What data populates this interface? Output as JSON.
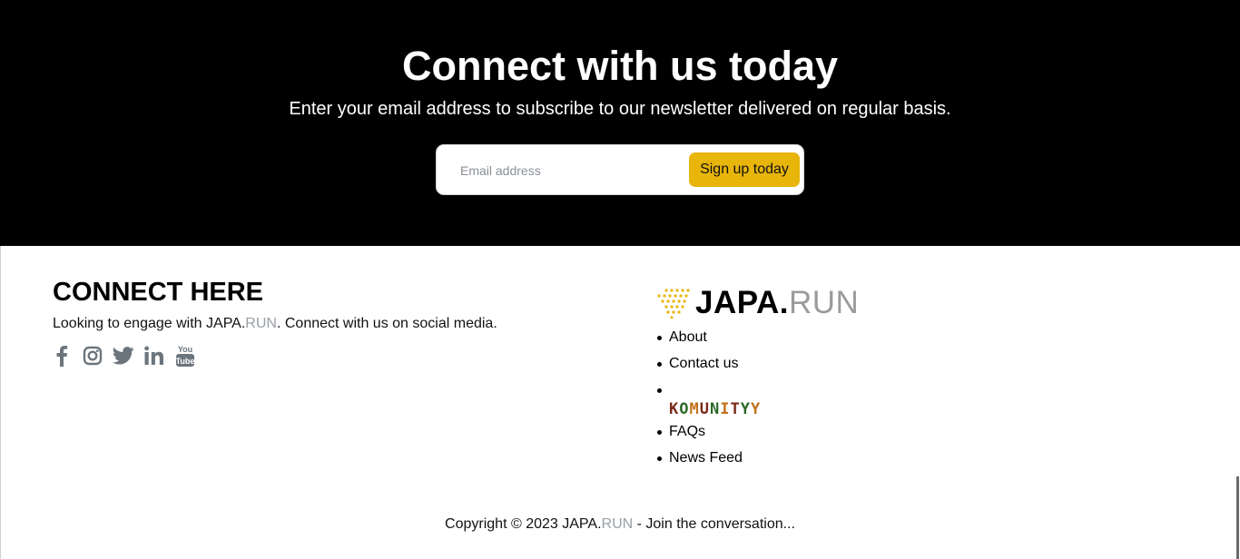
{
  "newsletter": {
    "title": "Connect with us today",
    "subtitle": "Enter your email address to subscribe to our newsletter delivered on regular basis.",
    "email_placeholder": "Email address",
    "button_label": "Sign up today",
    "button_color": "#e8b50a"
  },
  "connect": {
    "title": "CONNECT HERE",
    "text_before": "Looking to engage with JAPA.",
    "text_run": "RUN",
    "text_after": ". Connect with us on social media.",
    "social_icons": [
      "facebook-icon",
      "instagram-icon",
      "twitter-icon",
      "linkedin-icon",
      "youtube-icon"
    ]
  },
  "brand": {
    "logo_main": "JAPA.",
    "logo_run": "RUN",
    "logo_icon": "arrow-dots-icon",
    "accent_color": "#e8b50a"
  },
  "footer_links": [
    {
      "label": "About"
    },
    {
      "label": "Contact us"
    },
    {
      "label": "KOMUNITYY"
    },
    {
      "label": "FAQs"
    },
    {
      "label": "News Feed"
    }
  ],
  "copyright": {
    "prefix": "Copyright © 2023 JAPA.",
    "run": "RUN",
    "suffix": " - Join the conversation..."
  }
}
